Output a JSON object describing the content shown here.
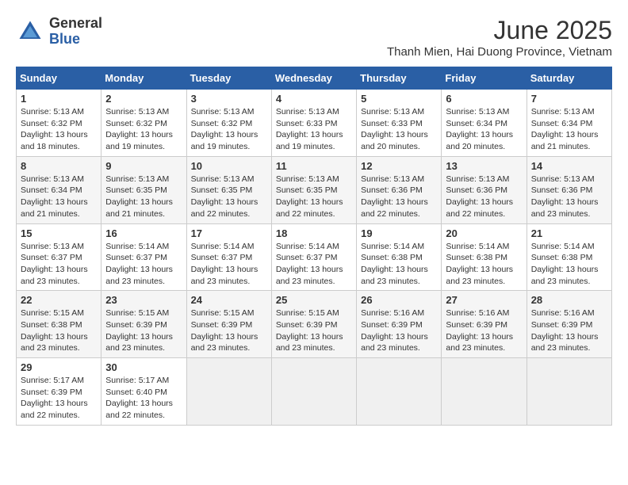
{
  "logo": {
    "general": "General",
    "blue": "Blue"
  },
  "title": {
    "month_year": "June 2025",
    "location": "Thanh Mien, Hai Duong Province, Vietnam"
  },
  "weekdays": [
    "Sunday",
    "Monday",
    "Tuesday",
    "Wednesday",
    "Thursday",
    "Friday",
    "Saturday"
  ],
  "weeks": [
    [
      {
        "day": 1,
        "sunrise": "5:13 AM",
        "sunset": "6:32 PM",
        "daylight": "13 hours and 18 minutes."
      },
      {
        "day": 2,
        "sunrise": "5:13 AM",
        "sunset": "6:32 PM",
        "daylight": "13 hours and 19 minutes."
      },
      {
        "day": 3,
        "sunrise": "5:13 AM",
        "sunset": "6:32 PM",
        "daylight": "13 hours and 19 minutes."
      },
      {
        "day": 4,
        "sunrise": "5:13 AM",
        "sunset": "6:33 PM",
        "daylight": "13 hours and 19 minutes."
      },
      {
        "day": 5,
        "sunrise": "5:13 AM",
        "sunset": "6:33 PM",
        "daylight": "13 hours and 20 minutes."
      },
      {
        "day": 6,
        "sunrise": "5:13 AM",
        "sunset": "6:34 PM",
        "daylight": "13 hours and 20 minutes."
      },
      {
        "day": 7,
        "sunrise": "5:13 AM",
        "sunset": "6:34 PM",
        "daylight": "13 hours and 21 minutes."
      }
    ],
    [
      {
        "day": 8,
        "sunrise": "5:13 AM",
        "sunset": "6:34 PM",
        "daylight": "13 hours and 21 minutes."
      },
      {
        "day": 9,
        "sunrise": "5:13 AM",
        "sunset": "6:35 PM",
        "daylight": "13 hours and 21 minutes."
      },
      {
        "day": 10,
        "sunrise": "5:13 AM",
        "sunset": "6:35 PM",
        "daylight": "13 hours and 22 minutes."
      },
      {
        "day": 11,
        "sunrise": "5:13 AM",
        "sunset": "6:35 PM",
        "daylight": "13 hours and 22 minutes."
      },
      {
        "day": 12,
        "sunrise": "5:13 AM",
        "sunset": "6:36 PM",
        "daylight": "13 hours and 22 minutes."
      },
      {
        "day": 13,
        "sunrise": "5:13 AM",
        "sunset": "6:36 PM",
        "daylight": "13 hours and 22 minutes."
      },
      {
        "day": 14,
        "sunrise": "5:13 AM",
        "sunset": "6:36 PM",
        "daylight": "13 hours and 23 minutes."
      }
    ],
    [
      {
        "day": 15,
        "sunrise": "5:13 AM",
        "sunset": "6:37 PM",
        "daylight": "13 hours and 23 minutes."
      },
      {
        "day": 16,
        "sunrise": "5:14 AM",
        "sunset": "6:37 PM",
        "daylight": "13 hours and 23 minutes."
      },
      {
        "day": 17,
        "sunrise": "5:14 AM",
        "sunset": "6:37 PM",
        "daylight": "13 hours and 23 minutes."
      },
      {
        "day": 18,
        "sunrise": "5:14 AM",
        "sunset": "6:37 PM",
        "daylight": "13 hours and 23 minutes."
      },
      {
        "day": 19,
        "sunrise": "5:14 AM",
        "sunset": "6:38 PM",
        "daylight": "13 hours and 23 minutes."
      },
      {
        "day": 20,
        "sunrise": "5:14 AM",
        "sunset": "6:38 PM",
        "daylight": "13 hours and 23 minutes."
      },
      {
        "day": 21,
        "sunrise": "5:14 AM",
        "sunset": "6:38 PM",
        "daylight": "13 hours and 23 minutes."
      }
    ],
    [
      {
        "day": 22,
        "sunrise": "5:15 AM",
        "sunset": "6:38 PM",
        "daylight": "13 hours and 23 minutes."
      },
      {
        "day": 23,
        "sunrise": "5:15 AM",
        "sunset": "6:39 PM",
        "daylight": "13 hours and 23 minutes."
      },
      {
        "day": 24,
        "sunrise": "5:15 AM",
        "sunset": "6:39 PM",
        "daylight": "13 hours and 23 minutes."
      },
      {
        "day": 25,
        "sunrise": "5:15 AM",
        "sunset": "6:39 PM",
        "daylight": "13 hours and 23 minutes."
      },
      {
        "day": 26,
        "sunrise": "5:16 AM",
        "sunset": "6:39 PM",
        "daylight": "13 hours and 23 minutes."
      },
      {
        "day": 27,
        "sunrise": "5:16 AM",
        "sunset": "6:39 PM",
        "daylight": "13 hours and 23 minutes."
      },
      {
        "day": 28,
        "sunrise": "5:16 AM",
        "sunset": "6:39 PM",
        "daylight": "13 hours and 23 minutes."
      }
    ],
    [
      {
        "day": 29,
        "sunrise": "5:17 AM",
        "sunset": "6:39 PM",
        "daylight": "13 hours and 22 minutes."
      },
      {
        "day": 30,
        "sunrise": "5:17 AM",
        "sunset": "6:40 PM",
        "daylight": "13 hours and 22 minutes."
      },
      null,
      null,
      null,
      null,
      null
    ]
  ]
}
